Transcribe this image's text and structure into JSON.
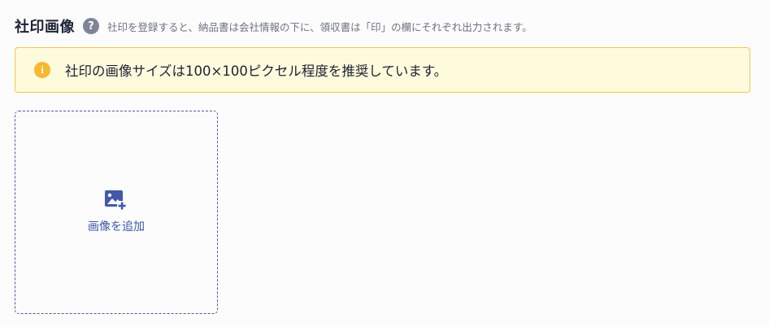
{
  "header": {
    "title": "社印画像",
    "help_icon": "question-circle-icon",
    "help_glyph": "?",
    "description": "社印を登録すると、納品書は会社情報の下に、領収書は「印」の欄にそれぞれ出力されます。"
  },
  "notice": {
    "icon": "info-icon",
    "icon_glyph": "i",
    "text": "社印の画像サイズは100×100ピクセル程度を推奨しています。",
    "background_color": "#fefadc",
    "border_color": "#f3c84a",
    "icon_color": "#f7b731"
  },
  "upload": {
    "icon": "add-image-icon",
    "label": "画像を追加",
    "accent_color": "#3d56a6"
  }
}
